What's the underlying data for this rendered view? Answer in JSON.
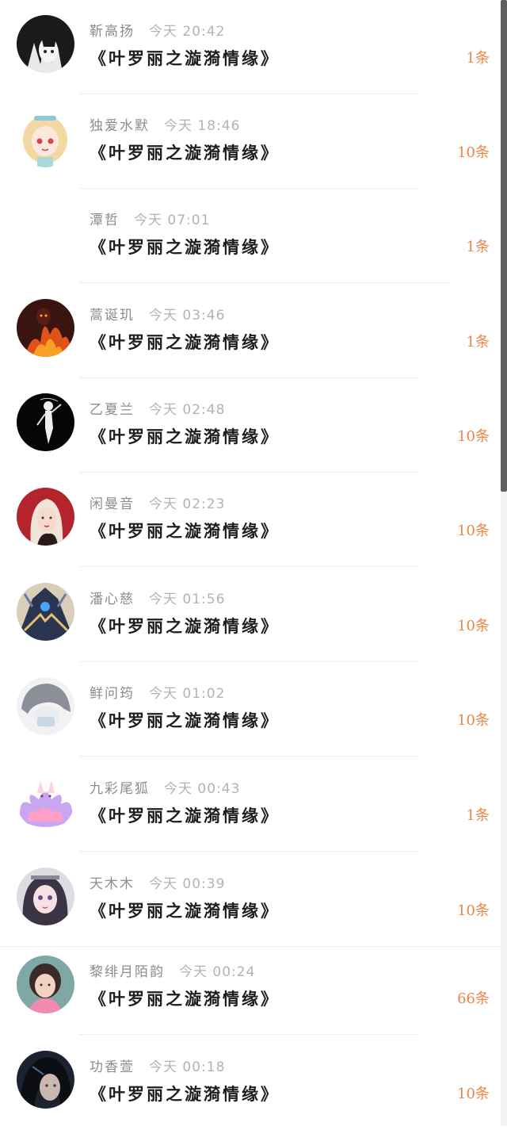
{
  "rows": [
    {
      "user": "靳高扬",
      "day": "今天",
      "time": "20:42",
      "title": "《叶罗丽之漩漪情缘》",
      "count": "1条",
      "avatar": "black-hair-avatar"
    },
    {
      "user": "独爱水默",
      "day": "今天",
      "time": "18:46",
      "title": "《叶罗丽之漩漪情缘》",
      "count": "10条",
      "avatar": "blonde-girl-avatar"
    },
    {
      "user": "潭哲",
      "day": "今天",
      "time": "07:01",
      "title": "《叶罗丽之漩漪情缘》",
      "count": "1条",
      "avatar": "none"
    },
    {
      "user": "蒿诞玑",
      "day": "今天",
      "time": "03:46",
      "title": "《叶罗丽之漩漪情缘》",
      "count": "1条",
      "avatar": "fire-figure-avatar"
    },
    {
      "user": "乙夏兰",
      "day": "今天",
      "time": "02:48",
      "title": "《叶罗丽之漩漪情缘》",
      "count": "10条",
      "avatar": "white-figure-avatar"
    },
    {
      "user": "闲曼音",
      "day": "今天",
      "time": "02:23",
      "title": "《叶罗丽之漩漪情缘》",
      "count": "10条",
      "avatar": "red-girl-avatar"
    },
    {
      "user": "潘心慈",
      "day": "今天",
      "time": "01:56",
      "title": "《叶罗丽之漩漪情缘》",
      "count": "10条",
      "avatar": "robot-avatar"
    },
    {
      "user": "鲜问筠",
      "day": "今天",
      "time": "01:02",
      "title": "《叶罗丽之漩漪情缘》",
      "count": "10条",
      "avatar": "hooded-avatar"
    },
    {
      "user": "九彩尾狐",
      "day": "今天",
      "time": "00:43",
      "title": "《叶罗丽之漩漪情缘》",
      "count": "1条",
      "avatar": "fox-avatar"
    },
    {
      "user": "天木木",
      "day": "今天",
      "time": "00:39",
      "title": "《叶罗丽之漩漪情缘》",
      "count": "10条",
      "avatar": "anime-girl-avatar"
    },
    {
      "user": "黎绯月陌韵",
      "day": "今天",
      "time": "00:24",
      "title": "《叶罗丽之漩漪情缘》",
      "count": "66条",
      "avatar": "child-avatar"
    },
    {
      "user": "功香萱",
      "day": "今天",
      "time": "00:18",
      "title": "《叶罗丽之漩漪情缘》",
      "count": "10条",
      "avatar": "dark-hair-avatar"
    }
  ],
  "colors": {
    "count": "#e8864a",
    "meta": "#9a9a9a",
    "title": "#1e1e1e"
  }
}
